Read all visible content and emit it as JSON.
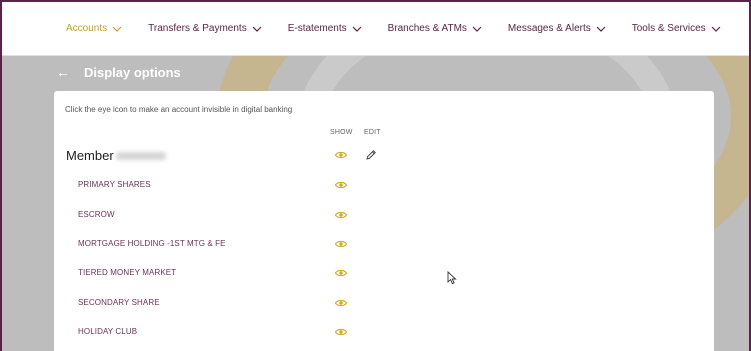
{
  "nav": {
    "items": [
      {
        "label": "Accounts",
        "active": true
      },
      {
        "label": "Transfers & Payments",
        "active": false
      },
      {
        "label": "E-statements",
        "active": false
      },
      {
        "label": "Branches & ATMs",
        "active": false
      },
      {
        "label": "Messages & Alerts",
        "active": false
      },
      {
        "label": "Tools & Services",
        "active": false
      }
    ]
  },
  "page": {
    "back_icon": "←",
    "title": "Display options"
  },
  "card": {
    "instructions": "Click the eye icon to make an account invisible in digital banking",
    "show_header": "SHOW",
    "edit_header": "EDIT",
    "member_label": "Member",
    "accounts": [
      {
        "label": "PRIMARY SHARES"
      },
      {
        "label": "ESCROW"
      },
      {
        "label": "MORTGAGE HOLDING -1ST MTG & FE"
      },
      {
        "label": "TIERED MONEY MARKET"
      },
      {
        "label": "SECONDARY SHARE"
      },
      {
        "label": "HOLIDAY CLUB"
      }
    ]
  },
  "colors": {
    "brand": "#5a2448",
    "accent": "#c89f2a",
    "eye": "#d4a81c"
  },
  "icons": [
    "chevron-down-icon",
    "back-arrow-icon",
    "eye-icon",
    "pencil-icon",
    "mouse-cursor-icon"
  ]
}
